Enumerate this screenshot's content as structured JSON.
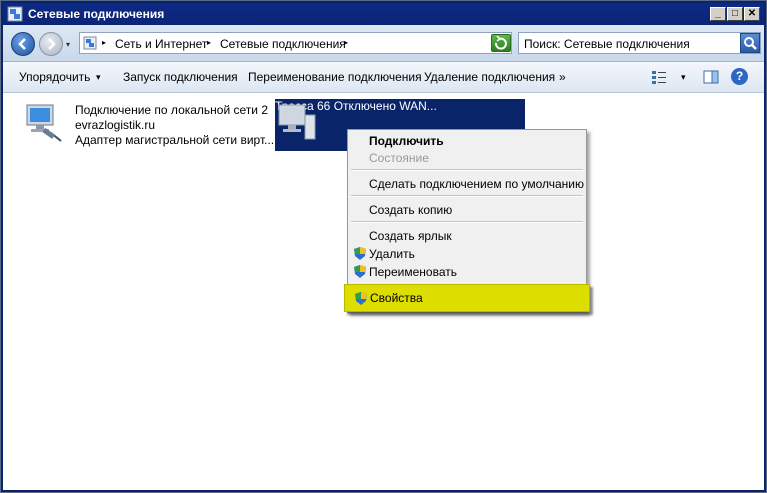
{
  "window": {
    "title": "Сетевые подключения",
    "min": "_",
    "max": "□",
    "close": "✕"
  },
  "address": {
    "crumb1": "Сеть и Интернет",
    "crumb2": "Сетевые подключения",
    "sep": "▸",
    "dd": "▾",
    "history": "▾",
    "search_placeholder": "Поиск: Сетевые подключения"
  },
  "toolbar": {
    "organize": "Упорядочить",
    "organize_arrow": "▾",
    "start": "Запуск подключения",
    "rename": "Переименование подключения",
    "delete": "Удаление подключения",
    "more": "»",
    "view_arrow": "▾",
    "help": "?"
  },
  "connections": [
    {
      "name": "Подключение по локальной сети 2",
      "line2": "evrazlogistik.ru",
      "line3": "Адаптер магистральной сети вирт..."
    },
    {
      "name": "Трасса 66",
      "line2": "Отключено",
      "line3": "WAN..."
    }
  ],
  "context_menu": {
    "connect": "Подключить",
    "status": "Состояние",
    "set_default": "Сделать подключением по умолчанию",
    "copy": "Создать копию",
    "shortcut": "Создать ярлык",
    "delete": "Удалить",
    "rename": "Переименовать",
    "properties": "Свойства"
  },
  "colors": {
    "selection": "#0a246a",
    "highlight": "#dddd00",
    "title_bar": "#0c2a86"
  }
}
